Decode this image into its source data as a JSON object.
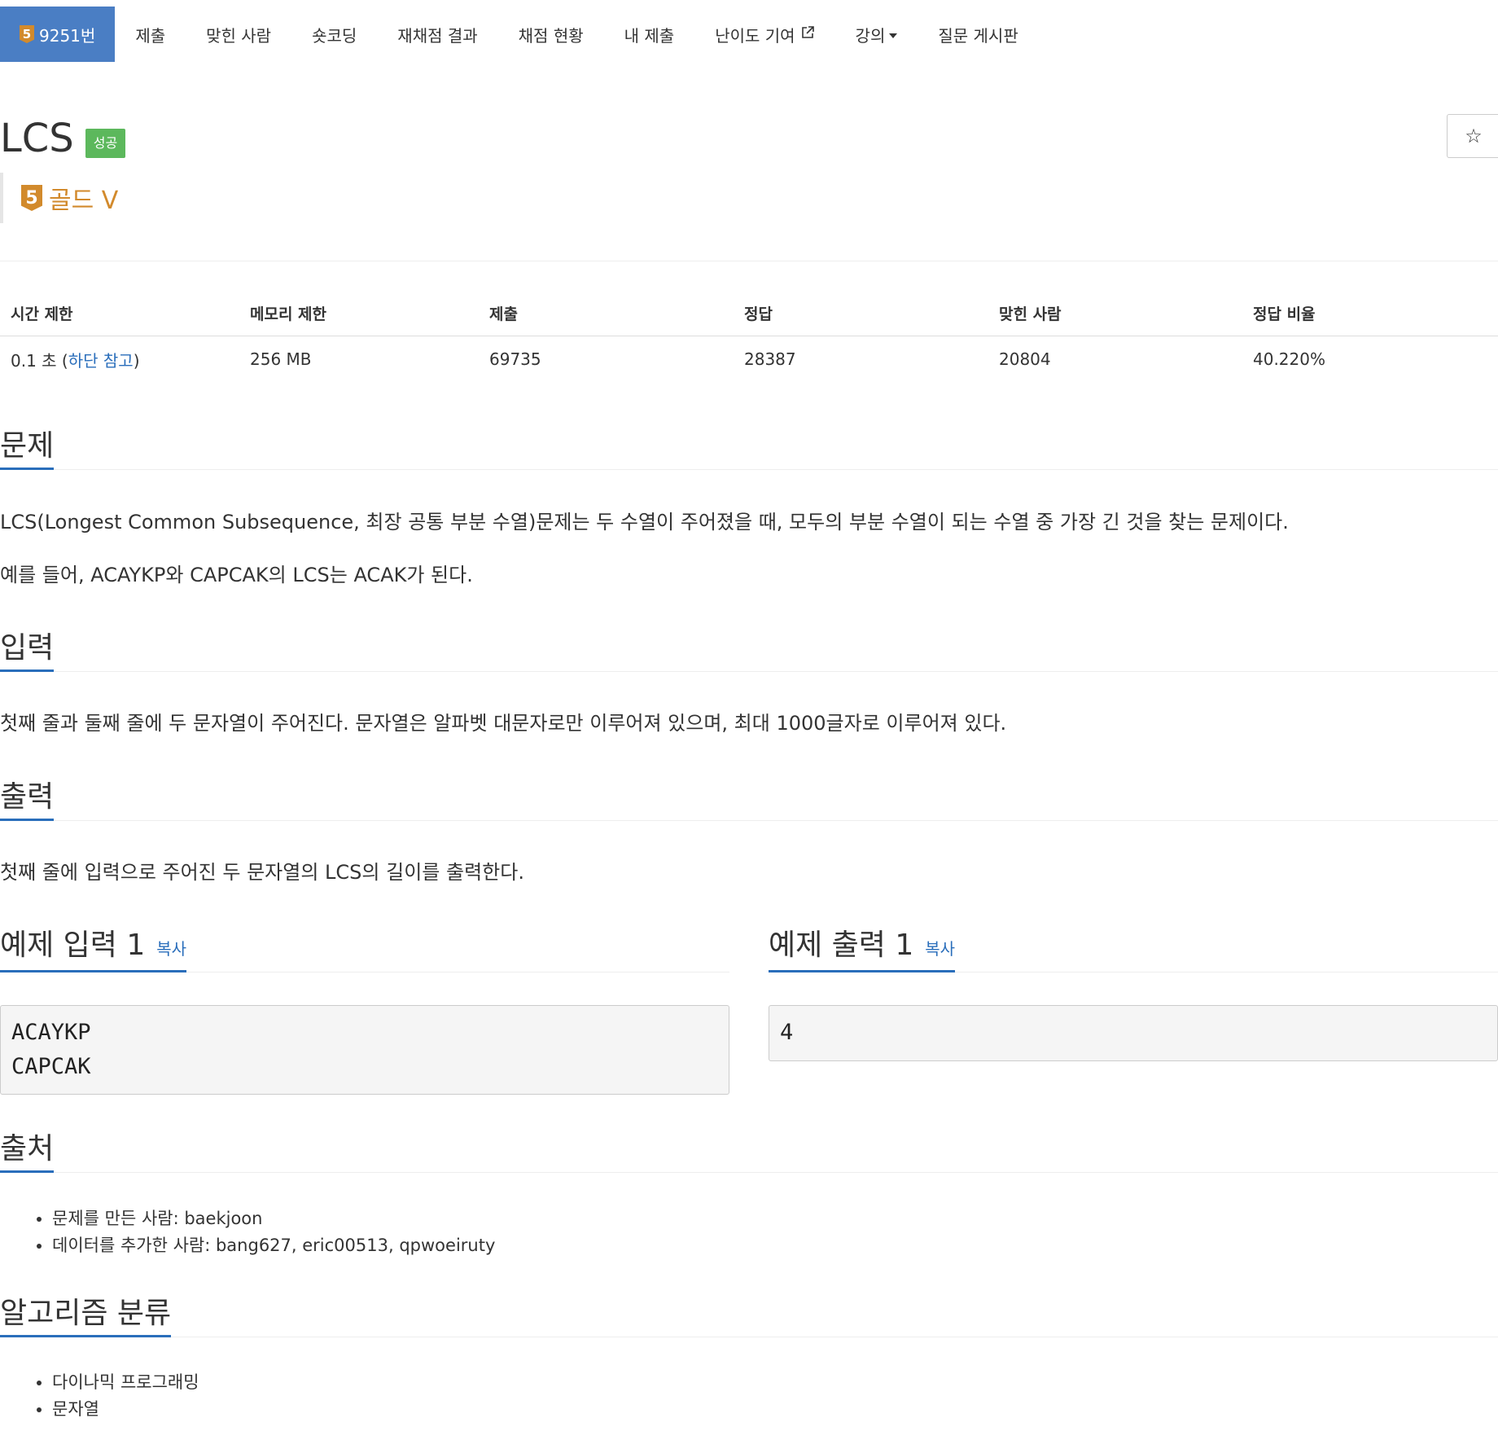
{
  "nav": {
    "problem_id": "9251번",
    "tier_number": "5",
    "items": [
      "제출",
      "맞힌 사람",
      "숏코딩",
      "재채점 결과",
      "채점 현황",
      "내 제출",
      "난이도 기여",
      "강의",
      "질문 게시판"
    ]
  },
  "problem": {
    "title": "LCS",
    "status_label": "성공",
    "tier_number": "5",
    "tier_text": "골드 V",
    "star_glyph": "☆"
  },
  "info": {
    "headers": [
      "시간 제한",
      "메모리 제한",
      "제출",
      "정답",
      "맞힌 사람",
      "정답 비율"
    ],
    "time_limit": "0.1 초 (",
    "time_limit_link": "하단 참고",
    "time_limit_suffix": ")",
    "memory_limit": "256 MB",
    "submissions": "69735",
    "accepted": "28387",
    "solvers": "20804",
    "ratio": "40.220%"
  },
  "sections": {
    "problem_title": "문제",
    "problem_p1": "LCS(Longest Common Subsequence, 최장 공통 부분 수열)문제는 두 수열이 주어졌을 때, 모두의 부분 수열이 되는 수열 중 가장 긴 것을 찾는 문제이다.",
    "problem_p2": "예를 들어, ACAYKP와 CAPCAK의 LCS는 ACAK가 된다.",
    "input_title": "입력",
    "input_p": "첫째 줄과 둘째 줄에 두 문자열이 주어진다. 문자열은 알파벳 대문자로만 이루어져 있으며, 최대 1000글자로 이루어져 있다.",
    "output_title": "출력",
    "output_p": "첫째 줄에 입력으로 주어진 두 문자열의 LCS의 길이를 출력한다.",
    "sample_input_title": "예제 입력 1",
    "sample_output_title": "예제 출력 1",
    "copy_label": "복사",
    "sample_input_line1": "ACAYKP",
    "sample_input_line2": "CAPCAK",
    "sample_output": "4",
    "source_title": "출처",
    "source_items": [
      "문제를 만든 사람: baekjoon",
      "데이터를 추가한 사람: bang627, eric00513, qpwoeiruty"
    ],
    "algo_title": "알고리즘 분류",
    "algo_items": [
      "다이나믹 프로그래밍",
      "문자열"
    ]
  }
}
